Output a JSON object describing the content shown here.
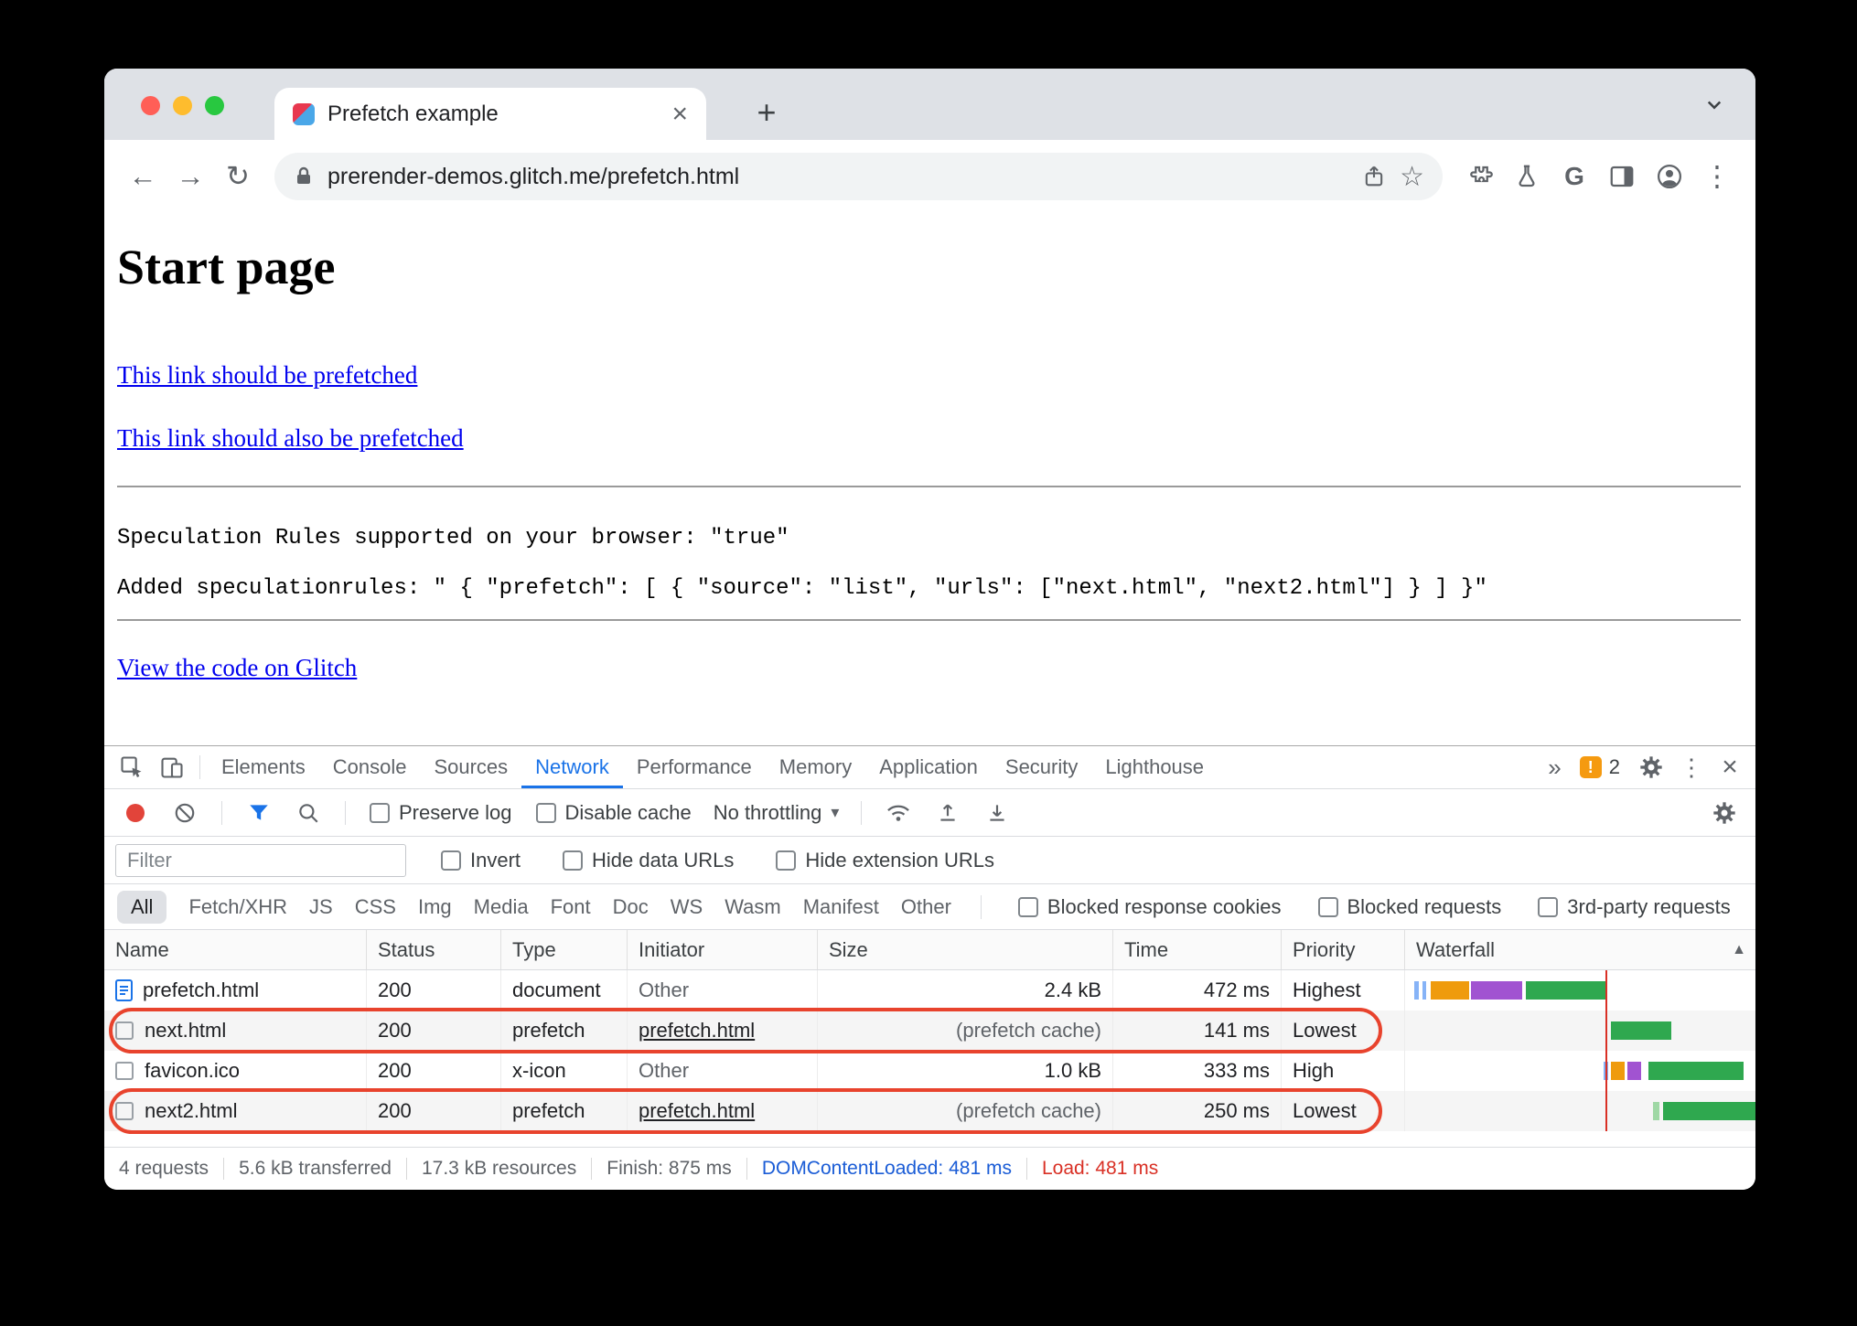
{
  "colors": {
    "accent_blue": "#1a73e8",
    "highlight_red": "#e8432d",
    "load_red": "#d93025",
    "dcl_blue": "#1a5cd6",
    "waterfall_green": "#2fa84f",
    "waterfall_orange": "#ef9b0d",
    "waterfall_purple": "#a153d1",
    "tabstrip_gray": "#dee1e6"
  },
  "icons": {
    "back": "←",
    "forward": "→",
    "reload": "↻",
    "star": "☆",
    "kebab": "⋮",
    "more_tabs": "»",
    "caret_down": "▾",
    "sort_asc": "▲",
    "close": "×",
    "new_tab": "+",
    "google_g": "G",
    "issues": "!"
  },
  "browser": {
    "tab_title": "Prefetch example",
    "url": "prerender-demos.glitch.me/prefetch.html"
  },
  "page": {
    "title": "Start page",
    "link1": "This link should be prefetched",
    "link2": "This link should also be prefetched",
    "mono1": "Speculation Rules supported on your browser: \"true\"",
    "mono2": "Added speculationrules: \" { \"prefetch\": [ { \"source\": \"list\", \"urls\": [\"next.html\", \"next2.html\"] } ] }\"",
    "footer_link": "View the code on Glitch"
  },
  "devtools": {
    "tabs": [
      "Elements",
      "Console",
      "Sources",
      "Network",
      "Performance",
      "Memory",
      "Application",
      "Security",
      "Lighthouse"
    ],
    "issues_count": "2",
    "toolbar": {
      "preserve_log": "Preserve log",
      "disable_cache": "Disable cache",
      "throttling": "No throttling"
    },
    "filter": {
      "placeholder": "Filter",
      "invert": "Invert",
      "hide_data": "Hide data URLs",
      "hide_ext": "Hide extension URLs"
    },
    "chips": [
      "All",
      "Fetch/XHR",
      "JS",
      "CSS",
      "Img",
      "Media",
      "Font",
      "Doc",
      "WS",
      "Wasm",
      "Manifest",
      "Other"
    ],
    "chip_checks": [
      "Blocked response cookies",
      "Blocked requests",
      "3rd-party requests"
    ],
    "columns": [
      "Name",
      "Status",
      "Type",
      "Initiator",
      "Size",
      "Time",
      "Priority",
      "Waterfall"
    ],
    "rows": [
      {
        "name": "prefetch.html",
        "status": "200",
        "type": "document",
        "initiator": "Other",
        "size": "2.4 kB",
        "time": "472 ms",
        "priority": "Highest"
      },
      {
        "name": "next.html",
        "status": "200",
        "type": "prefetch",
        "initiator": "prefetch.html",
        "size": "(prefetch cache)",
        "time": "141 ms",
        "priority": "Lowest"
      },
      {
        "name": "favicon.ico",
        "status": "200",
        "type": "x-icon",
        "initiator": "Other",
        "size": "1.0 kB",
        "time": "333 ms",
        "priority": "High"
      },
      {
        "name": "next2.html",
        "status": "200",
        "type": "prefetch",
        "initiator": "prefetch.html",
        "size": "(prefetch cache)",
        "time": "250 ms",
        "priority": "Lowest"
      }
    ],
    "summary": [
      "4 requests",
      "5.6 kB transferred",
      "17.3 kB resources",
      "Finish: 875 ms",
      "DOMContentLoaded: 481 ms",
      "Load: 481 ms"
    ]
  }
}
